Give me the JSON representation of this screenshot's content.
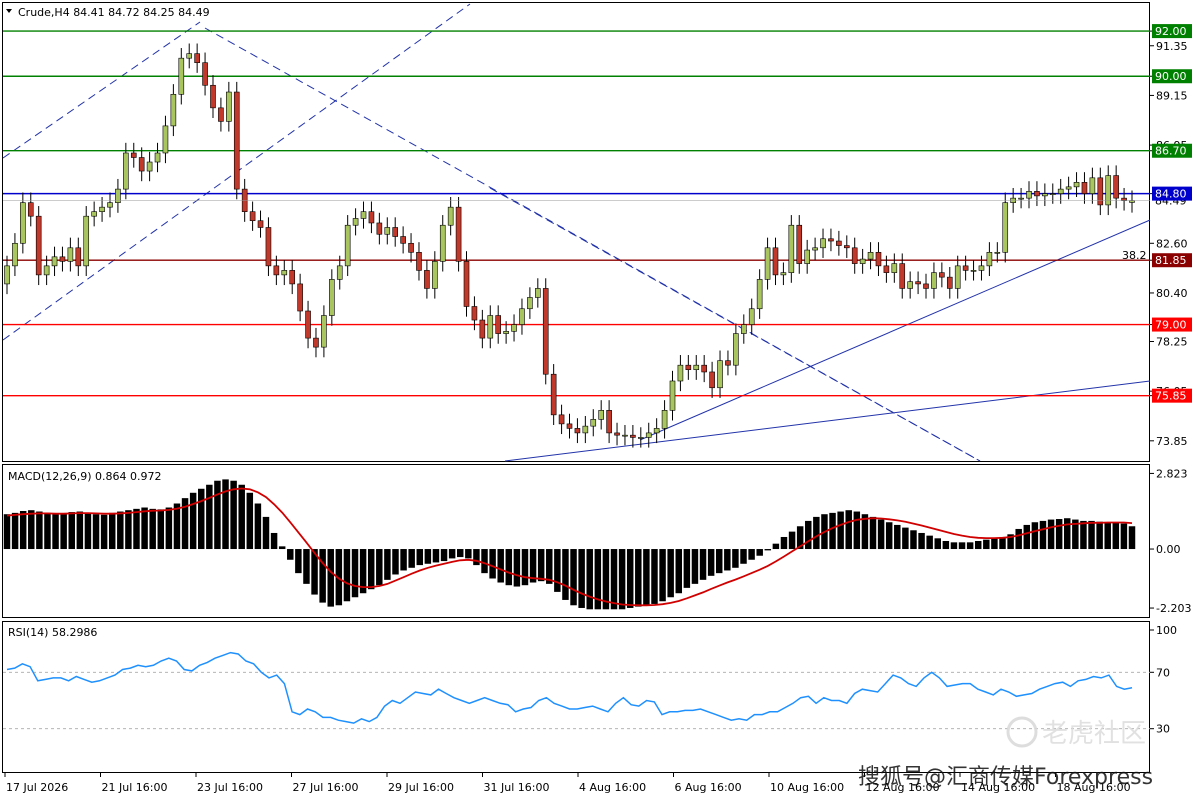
{
  "chart_data": {
    "type": "candlestick",
    "symbol": "Crude,H4",
    "header": "Crude,H4  84.41 84.72 84.25 84.49",
    "ohlc_last": {
      "open": 84.41,
      "high": 84.72,
      "low": 84.25,
      "close": 84.49
    },
    "current_price_label": "84.49",
    "price_axis": {
      "range": [
        73.0,
        93.2
      ],
      "ticks": [
        "92.00",
        "91.35",
        "90.00",
        "89.15",
        "86.95",
        "86.70",
        "84.80",
        "82.60",
        "81.85",
        "80.40",
        "79.00",
        "78.25",
        "76.05",
        "75.85",
        "73.85"
      ]
    },
    "horizontal_levels": [
      {
        "price": 92.0,
        "label": "92.00",
        "color": "#008000"
      },
      {
        "price": 90.0,
        "label": "90.00",
        "color": "#008000"
      },
      {
        "price": 86.7,
        "label": "86.70",
        "color": "#008000"
      },
      {
        "price": 84.8,
        "label": "84.80",
        "color": "#0000cc"
      },
      {
        "price": 81.85,
        "label": "81.85",
        "color": "#8b0000"
      },
      {
        "price": 79.0,
        "label": "79.00",
        "color": "#ff0000"
      },
      {
        "price": 75.85,
        "label": "75.85",
        "color": "#ff0000"
      }
    ],
    "fib_label": "38.2",
    "candles": {
      "bull_color": "#a8c560",
      "bear_color": "#c0392b",
      "close": [
        81.6,
        82.6,
        84.4,
        83.8,
        81.2,
        81.6,
        82.0,
        81.8,
        82.4,
        81.6,
        83.8,
        84.0,
        84.2,
        84.4,
        85.0,
        86.6,
        86.4,
        85.8,
        86.2,
        86.6,
        87.8,
        89.2,
        90.8,
        91.0,
        90.6,
        89.6,
        88.6,
        88.0,
        89.3,
        85.0,
        84.0,
        83.6,
        83.3,
        81.6,
        81.2,
        81.4,
        80.8,
        79.6,
        78.4,
        78.0,
        79.4,
        81.0,
        81.6,
        83.4,
        83.7,
        84.0,
        83.5,
        83.0,
        83.3,
        82.9,
        82.6,
        82.2,
        81.4,
        80.6,
        81.8,
        83.4,
        84.2,
        81.8,
        79.8,
        79.2,
        78.4,
        79.4,
        78.6,
        78.7,
        79.0,
        79.7,
        80.2,
        80.6,
        76.8,
        75.0,
        74.6,
        74.4,
        74.2,
        74.5,
        74.8,
        75.2,
        74.2,
        74.1,
        74.1,
        74.0,
        74.0,
        74.2,
        74.4,
        75.2,
        76.5,
        77.2,
        77.0,
        77.2,
        76.9,
        76.2,
        77.4,
        77.2,
        78.6,
        79.0,
        79.7,
        81.0,
        82.4,
        81.2,
        81.3,
        83.4,
        81.7,
        82.3,
        82.4,
        82.8,
        82.7,
        82.5,
        82.4,
        81.7,
        81.9,
        82.2,
        81.6,
        81.3,
        81.7,
        80.6,
        80.9,
        80.8,
        80.6,
        81.3,
        81.1,
        80.6,
        81.6,
        81.4,
        81.4,
        81.6,
        82.2,
        82.2,
        84.4,
        84.6,
        84.6,
        84.9,
        84.7,
        84.8,
        84.8,
        85.0,
        85.1,
        85.3,
        84.8,
        85.5,
        84.3,
        85.6,
        84.6,
        84.5,
        84.49
      ],
      "open": [
        80.8,
        81.6,
        82.6,
        84.4,
        83.8,
        81.2,
        81.6,
        82.0,
        81.8,
        82.4,
        81.6,
        83.8,
        84.0,
        84.2,
        84.4,
        85.0,
        86.6,
        86.4,
        85.8,
        86.2,
        86.6,
        87.8,
        89.2,
        90.8,
        91.0,
        90.6,
        89.6,
        88.6,
        88.0,
        89.3,
        85.0,
        84.0,
        83.6,
        83.3,
        81.6,
        81.2,
        81.4,
        80.8,
        79.6,
        78.4,
        78.0,
        79.4,
        81.0,
        81.6,
        83.4,
        83.7,
        84.0,
        83.5,
        83.0,
        83.3,
        82.9,
        82.6,
        82.2,
        81.4,
        80.6,
        81.8,
        83.4,
        84.2,
        81.8,
        79.8,
        79.2,
        78.4,
        79.4,
        78.6,
        78.7,
        79.0,
        79.7,
        80.2,
        80.6,
        76.8,
        75.0,
        74.6,
        74.4,
        74.2,
        74.5,
        74.8,
        75.2,
        74.2,
        74.1,
        74.1,
        74.0,
        74.0,
        74.2,
        74.4,
        75.2,
        76.5,
        77.2,
        77.0,
        77.2,
        76.9,
        76.2,
        77.4,
        77.2,
        78.6,
        79.0,
        79.7,
        81.0,
        82.4,
        81.2,
        81.3,
        83.4,
        81.7,
        82.3,
        82.4,
        82.8,
        82.7,
        82.5,
        82.4,
        81.7,
        81.9,
        82.2,
        81.6,
        81.3,
        81.7,
        80.6,
        80.9,
        80.8,
        80.6,
        81.3,
        81.1,
        80.6,
        81.6,
        81.4,
        81.4,
        81.6,
        82.2,
        82.2,
        84.4,
        84.6,
        84.6,
        84.9,
        84.7,
        84.8,
        84.8,
        85.0,
        85.1,
        85.3,
        84.8,
        85.5,
        84.3,
        85.6,
        84.6,
        84.41
      ]
    },
    "macd": {
      "label": "MACD(12,26,9) 0.864 0.972",
      "ticks": [
        "2.823",
        "0.00",
        "-2.203"
      ],
      "range": [
        -2.5,
        3.1
      ],
      "histogram": [
        1.3,
        1.35,
        1.42,
        1.45,
        1.4,
        1.35,
        1.3,
        1.32,
        1.38,
        1.4,
        1.35,
        1.3,
        1.28,
        1.35,
        1.4,
        1.45,
        1.5,
        1.55,
        1.5,
        1.48,
        1.55,
        1.7,
        1.9,
        2.1,
        2.25,
        2.4,
        2.55,
        2.6,
        2.55,
        2.4,
        2.1,
        1.7,
        1.2,
        0.6,
        0.1,
        -0.4,
        -0.9,
        -1.3,
        -1.7,
        -2.0,
        -2.15,
        -2.1,
        -1.95,
        -1.8,
        -1.65,
        -1.5,
        -1.35,
        -1.15,
        -0.95,
        -0.8,
        -0.7,
        -0.6,
        -0.55,
        -0.5,
        -0.45,
        -0.35,
        -0.3,
        -0.35,
        -0.6,
        -0.9,
        -1.1,
        -1.25,
        -1.35,
        -1.4,
        -1.35,
        -1.25,
        -1.2,
        -1.3,
        -1.6,
        -1.9,
        -2.1,
        -2.2,
        -2.25,
        -2.25,
        -2.25,
        -2.25,
        -2.25,
        -2.2,
        -2.15,
        -2.1,
        -2.05,
        -1.95,
        -1.8,
        -1.65,
        -1.45,
        -1.3,
        -1.15,
        -1.0,
        -0.9,
        -0.8,
        -0.7,
        -0.55,
        -0.4,
        -0.25,
        -0.05,
        0.2,
        0.45,
        0.65,
        0.85,
        1.05,
        1.2,
        1.3,
        1.35,
        1.4,
        1.45,
        1.4,
        1.3,
        1.2,
        1.1,
        1.0,
        0.9,
        0.8,
        0.7,
        0.6,
        0.5,
        0.4,
        0.3,
        0.25,
        0.25,
        0.25,
        0.3,
        0.35,
        0.4,
        0.45,
        0.55,
        0.75,
        0.9,
        1.0,
        1.05,
        1.1,
        1.12,
        1.15,
        1.1,
        1.05,
        1.05,
        1.02,
        1.0,
        1.0,
        0.95,
        0.85
      ],
      "signal": [
        1.25,
        1.28,
        1.3,
        1.32,
        1.33,
        1.33,
        1.32,
        1.32,
        1.33,
        1.34,
        1.34,
        1.33,
        1.32,
        1.32,
        1.33,
        1.35,
        1.38,
        1.41,
        1.43,
        1.44,
        1.46,
        1.51,
        1.58,
        1.68,
        1.79,
        1.91,
        2.04,
        2.15,
        2.23,
        2.26,
        2.23,
        2.12,
        1.94,
        1.67,
        1.36,
        1.0,
        0.62,
        0.24,
        -0.15,
        -0.52,
        -0.85,
        -1.1,
        -1.28,
        -1.38,
        -1.42,
        -1.42,
        -1.38,
        -1.3,
        -1.18,
        -1.05,
        -0.92,
        -0.8,
        -0.7,
        -0.62,
        -0.55,
        -0.48,
        -0.42,
        -0.4,
        -0.44,
        -0.53,
        -0.64,
        -0.76,
        -0.88,
        -0.98,
        -1.05,
        -1.09,
        -1.11,
        -1.15,
        -1.24,
        -1.37,
        -1.52,
        -1.66,
        -1.78,
        -1.88,
        -1.96,
        -2.02,
        -2.07,
        -2.09,
        -2.1,
        -2.1,
        -2.09,
        -2.06,
        -2.01,
        -1.94,
        -1.84,
        -1.73,
        -1.62,
        -1.49,
        -1.37,
        -1.25,
        -1.14,
        -1.02,
        -0.9,
        -0.77,
        -0.63,
        -0.46,
        -0.28,
        -0.09,
        0.1,
        0.29,
        0.47,
        0.64,
        0.78,
        0.9,
        1.01,
        1.09,
        1.13,
        1.15,
        1.14,
        1.11,
        1.07,
        1.02,
        0.95,
        0.88,
        0.8,
        0.72,
        0.64,
        0.56,
        0.5,
        0.45,
        0.42,
        0.41,
        0.41,
        0.42,
        0.45,
        0.51,
        0.59,
        0.67,
        0.74,
        0.81,
        0.87,
        0.92,
        0.94,
        0.96,
        0.98,
        0.98,
        0.99,
        0.99,
        0.99,
        0.97
      ]
    },
    "rsi": {
      "label": "RSI(14) 58.2986",
      "ticks": [
        "100",
        "70",
        "30"
      ],
      "range": [
        0,
        100
      ],
      "levels": [
        70,
        30
      ],
      "values": [
        72,
        73,
        76,
        74,
        64,
        65,
        66,
        66,
        64,
        67,
        65,
        63,
        64,
        66,
        68,
        72,
        73,
        75,
        74,
        75,
        78,
        80,
        78,
        72,
        71,
        75,
        77,
        80,
        82,
        84,
        83,
        78,
        76,
        70,
        66,
        68,
        62,
        42,
        40,
        44,
        42,
        38,
        38,
        36,
        35,
        34,
        37,
        35,
        38,
        46,
        50,
        48,
        52,
        56,
        55,
        54,
        58,
        55,
        52,
        50,
        48,
        50,
        52,
        50,
        48,
        47,
        42,
        44,
        45,
        50,
        52,
        48,
        46,
        44,
        44,
        45,
        46,
        44,
        42,
        48,
        52,
        47,
        46,
        50,
        49,
        40,
        42,
        42,
        43,
        43,
        44,
        42,
        40,
        38,
        36,
        37,
        36,
        40,
        40,
        42,
        42,
        45,
        48,
        52,
        53,
        48,
        52,
        50,
        50,
        48,
        55,
        58,
        57,
        56,
        62,
        68,
        66,
        62,
        60,
        66,
        70,
        66,
        60,
        61,
        62,
        62,
        58,
        56,
        54,
        58,
        56,
        53,
        54,
        55,
        58,
        60,
        62,
        63,
        60,
        64,
        65,
        67,
        66,
        68,
        60,
        58,
        59
      ],
      "x_labels": [
        "17 Jul 2026",
        "21 Jul 16:00",
        "23 Jul 16:00",
        "27 Jul 16:00",
        "29 Jul 16:00",
        "31 Jul 16:00",
        "4 Aug 16:00",
        "6 Aug 16:00",
        "10 Aug 16:00",
        "12 Aug 16:00",
        "14 Aug 16:00",
        "18 Aug 16:00"
      ]
    },
    "watermark": "搜狐号@汇商传媒Forexpress",
    "watermark2": "老虎社区"
  }
}
